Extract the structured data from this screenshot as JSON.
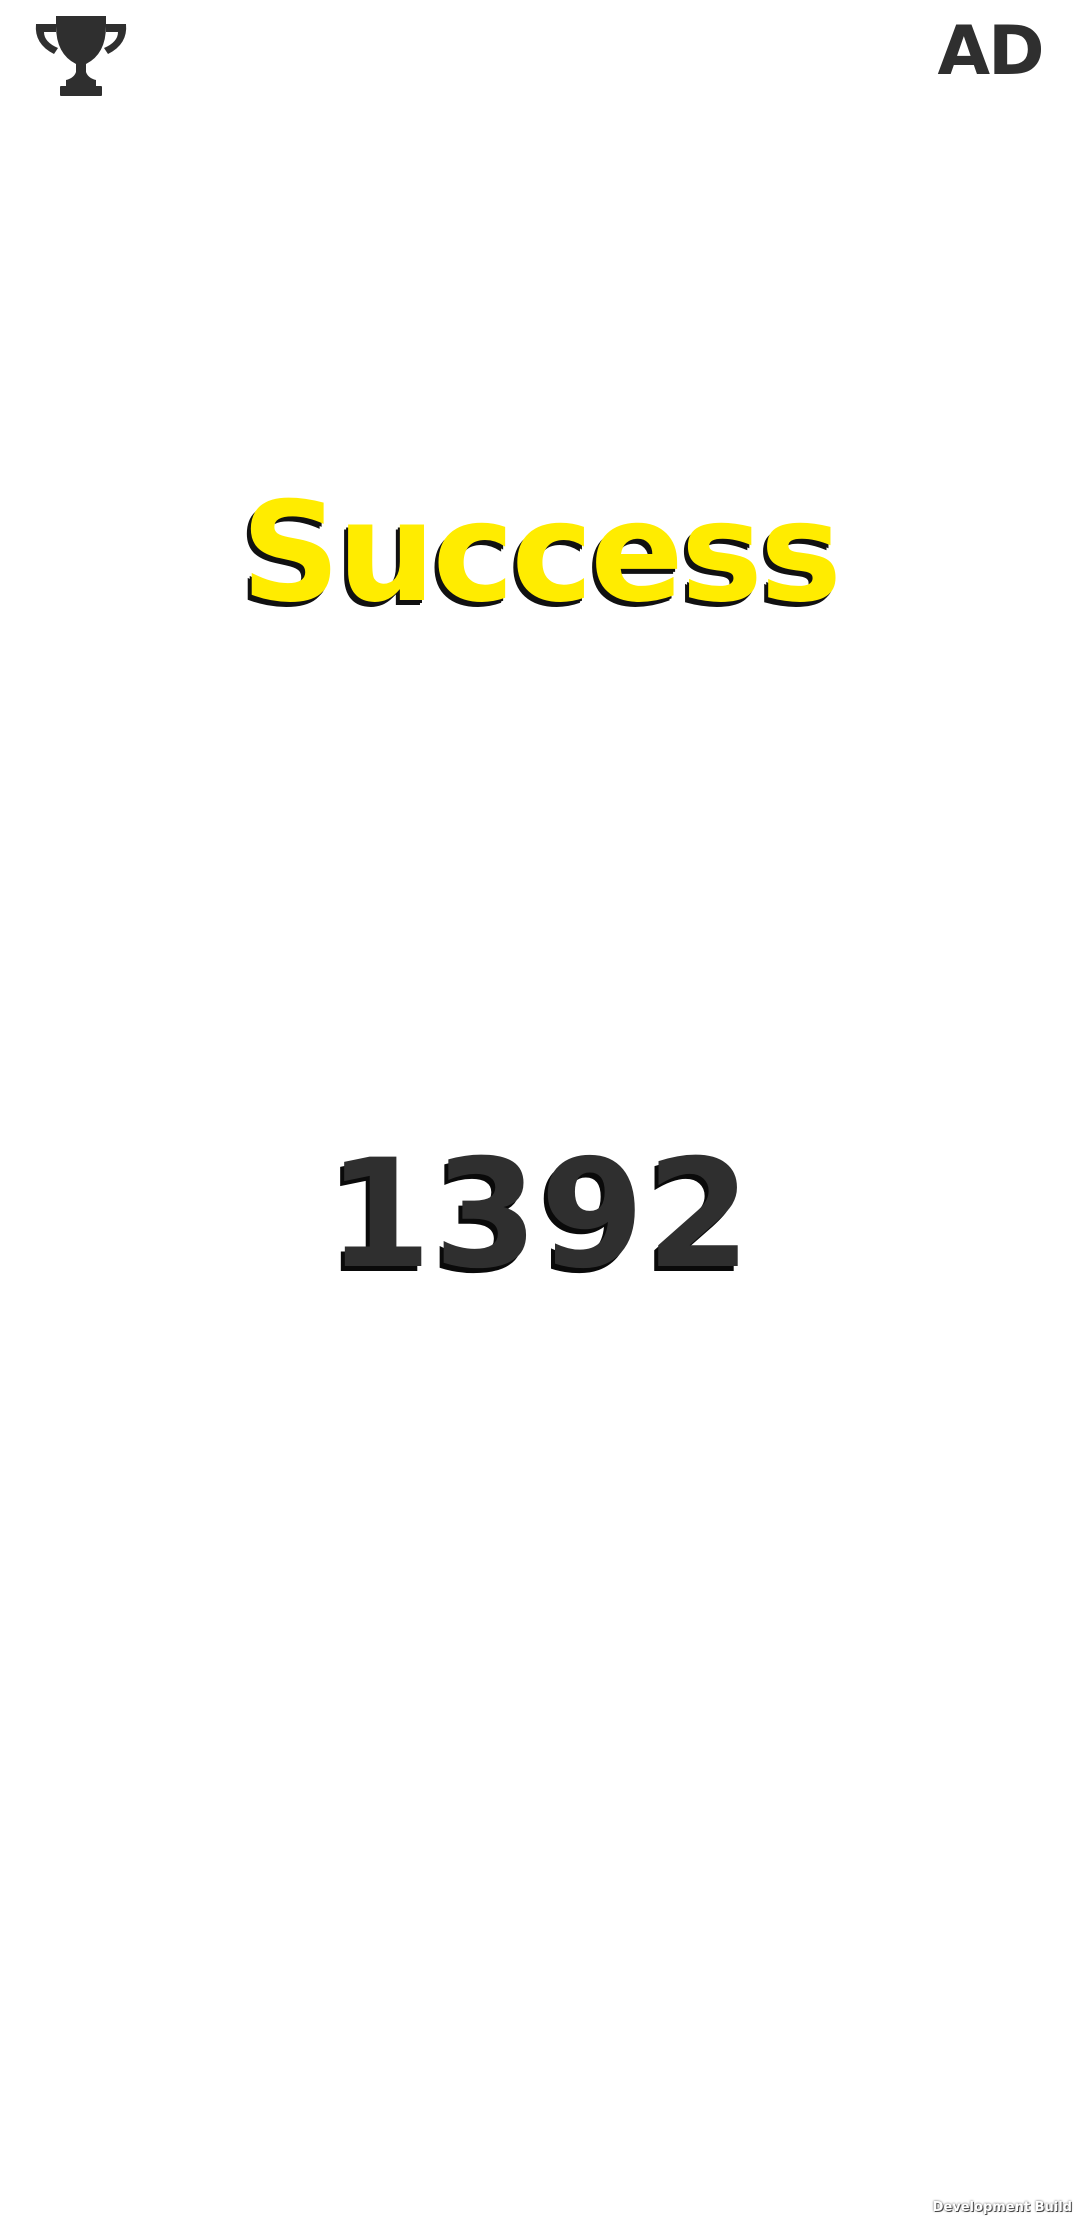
{
  "header": {
    "trophy_icon": "trophy-icon",
    "ad_label": "AD"
  },
  "main": {
    "title": "Success",
    "score": "1392"
  },
  "footer": {
    "build_label": "Development Build"
  },
  "colors": {
    "background": "#ffffff",
    "title": "#ffec00",
    "score": "#2f2f2f",
    "icon": "#2f2f2f",
    "shadow": "#111111"
  }
}
